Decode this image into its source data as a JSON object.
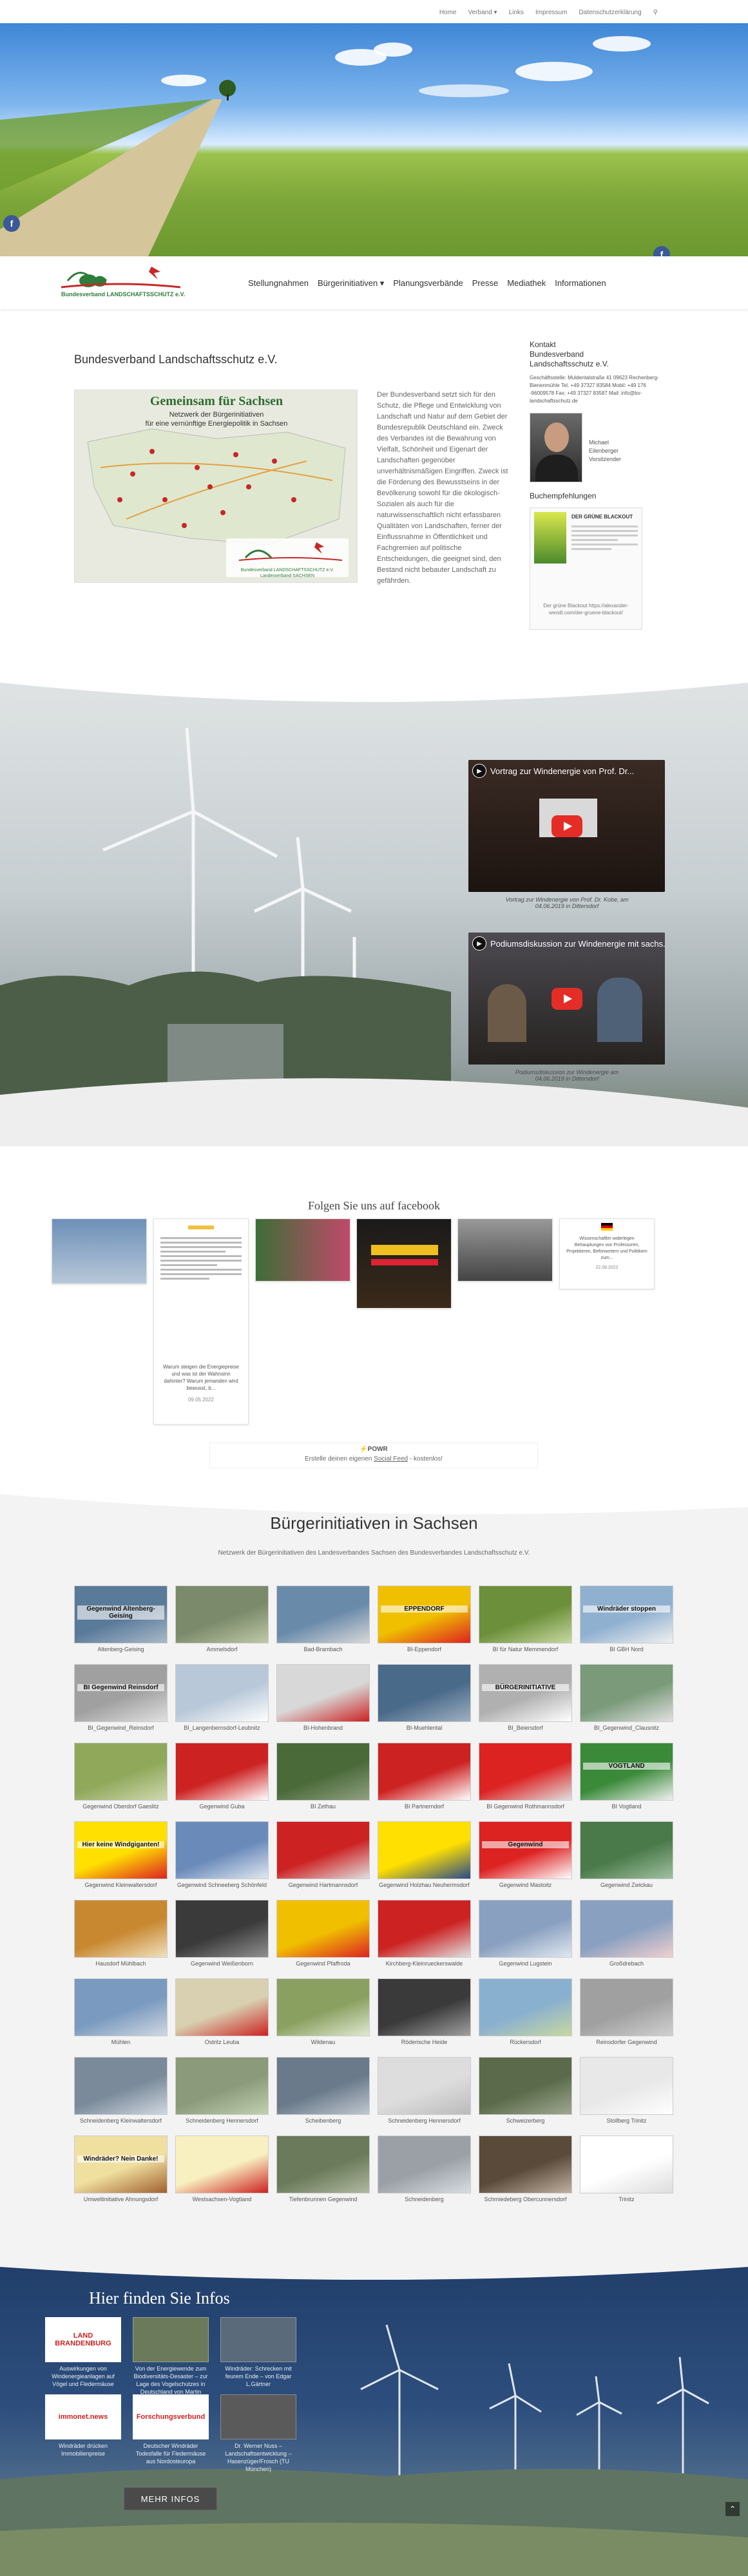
{
  "topnav": {
    "items": [
      "Home",
      "Verband",
      "Links",
      "Impressum",
      "Datenschutzerklärung"
    ]
  },
  "logo": {
    "text": "Bundesverband LANDSCHAFTSSCHUTZ e.V."
  },
  "menu": {
    "items": [
      "Stellungnahmen",
      "Bürgerinitiativen",
      "Planungsverbände",
      "Presse",
      "Mediathek",
      "Informationen"
    ]
  },
  "intro": {
    "heading": "Bundesverband Landschaftsschutz e.V.",
    "map_title": "Gemeinsam für Sachsen",
    "map_sub1": "Netzwerk der Bürgerinitiativen",
    "map_sub2": "für eine vernünftige Energiepolitik in Sachsen",
    "map_logo": "Bundesverband LANDSCHAFTSSCHUTZ e.V. Landesverband SACHSEN",
    "text": "Der Bundesverband setzt sich für den Schutz, die Pflege und Entwicklung von Landschaft und Natur auf dem Gebiet der Bundesrepublik Deutschland ein. Zweck des Verbandes ist die Bewahrung von Vielfalt, Schönheit und Eigenart der Landschaften gegenüber unverhältnismäßigen Eingriffen. Zweck ist die Förderung des Bewusstseins in der Bevölkerung sowohl für die ökologisch-Sozialen als auch für die naturwissenschaftlich nicht erfassbaren Qualitäten von Landschaften, ferner der Einflussnahme in Öffentlichkeit und Fachgremien auf politische Entscheidungen, die geeignet sind, den Bestand nicht bebauter Landschaft zu gefährden."
  },
  "sidebar": {
    "kontakt": "Kontakt",
    "org": "Bundesverband Landschaftsschutz e.V.",
    "address": "Geschäftsstelle: Muldentalstraße 41 09623 Rechenberg-Bienenmühle Tel. +49 37327 83584 Mobil: +49 176 -96009578 Fax: +49 37327 83587 Mail: info@bv-landschaftsschutz.de",
    "person": "Michael Eilenberger Vorsitzender",
    "buch_heading": "Buchempfehlungen",
    "book_title": "DER GRÜNE BLACKOUT",
    "book_caption": "Der grüne Blackout https://alexander-wendt.com/der-gruene-blackout/"
  },
  "videos": [
    {
      "title": "Vortrag zur Windenergie von Prof. Dr...",
      "caption": "Vortrag zur Windenergie von Prof. Dr. Kobe, am 04.06.2019 in Dittersdorf"
    },
    {
      "title": "Podiumsdiskussion zur Windenergie mit sachs...",
      "caption": "Podiumsdiskussion zur Windenergie am 04.06.2019 in Dittersdorf"
    }
  ],
  "facebook": {
    "heading": "Folgen Sie uns auf facebook",
    "post_text": "Warum steigen die Energiepreise und was ist der Wahnsinn dahinter? Warum jemanden wird bewusst, b...",
    "post_date": "09.05.2022",
    "post2_text": "Wissenschaftler widerlegen Behauptungen von Professoren, Projektieren, Befürwortern und Politikern zum...",
    "post2_date": "22.08.2022",
    "powr": "POWR",
    "powr_sub1": "Erstelle deinen eigenen",
    "powr_link": "Social Feed",
    "powr_sub2": "- kostenlos!"
  },
  "bi": {
    "heading": "Bürgerinitiativen in Sachsen",
    "sub": "Netzwerk der Bürgerinitiativen des Landesverbandes Sachsen des Bundesverbandes Landschaftsschutz e.V.",
    "items": [
      "Altenberg-Geising",
      "Ammelsdorf",
      "Bad-Brambach",
      "BI-Eppendorf",
      "BI für Natur Memmendorf",
      "BI GBH Nord",
      "BI_Gegenwind_Reinsdorf",
      "BI_Langenbernsdorf-Leubnitz",
      "BI-Hohenbrand",
      "BI-Muehlental",
      "BI_Beiersdorf",
      "BI_Gegenwind_Clausnitz",
      "Gegenwind Oberdorf Gaeslitz",
      "Gegenwind Guba",
      "BI Zethau",
      "BI Partnerndorf",
      "BI Gegenwind Rothmannsdorf",
      "BI Vogtland",
      "Gegenwind Kleinwaltersdorf",
      "Gegenwind Schneeberg Schönfeld",
      "Gegenwind Hartmannsdorf",
      "Gegenwind Holzhau Neuhermsdorf",
      "Gegenwind Mastoitz",
      "Gegenwind Zwickau",
      "Hausdorf Mühlbach",
      "Gegenwind Weißenborn",
      "Gegenwind Pfaffroda",
      "Kirchberg-Kleinrueckerswalde",
      "Gegenwind Lugstein",
      "Großdrebach",
      "Mühlen",
      "Ostritz Leuba",
      "Wildenau",
      "Röderische Heide",
      "Rückersdorf",
      "Reinsdorfer Gegenwind",
      "Schneidenberg Kleinwaltersdorf",
      "Schneidenberg Hennersdorf",
      "Scheibenberg",
      "Schneidenberg Hennersdorf",
      "Schweizerberg",
      "Stollberg Trinitz",
      "Umweltinitiative Ahnungsdorf",
      "Westsachsen-Vogtland",
      "Tiefenbrunnen Gegenwind",
      "Schneidenberg",
      "Schmiedeberg Obercunnersdorf",
      "Trinitz"
    ],
    "labels": {
      "i1": "Gegenwind Altenberg-Geising",
      "i4": "EPPENDORF",
      "i6": "Windräder stoppen",
      "i7": "BI Gegenwind Reinsdorf",
      "i11": "BÜRGERINITIATIVE",
      "i18": "VOGTLAND",
      "i19": "Hier keine Windgiganten!",
      "i23": "Gegenwind",
      "i43": "Windräder? Nein Danke!"
    }
  },
  "info": {
    "heading": "Hier finden Sie Infos",
    "items": [
      {
        "label": "LAND BRANDENBURG",
        "text": "Auswirkungen von Windenergieanlagen auf Vögel und Fledermäuse"
      },
      {
        "label": "",
        "text": "Von der Energiewende zum Biodiversitäts-Desaster – zur Lage des Vogelschutzes in Deutschland von Martin Flade"
      },
      {
        "label": "",
        "text": "Windräder: Schrecken mit feurem Ende – von Edgar L.Gärtner"
      },
      {
        "label": "immonet.news",
        "text": "Windräder drücken Immobilienpreise"
      },
      {
        "label": "Forschungsverbund",
        "text": "Deutscher Windräder Todesfalle für Fledermäuse aus Nordosteuropa"
      },
      {
        "label": "",
        "text": "Dr. Werner Nuss – Landschaftsentwicklung – Hasenzüger/Frosch (TU München)"
      }
    ],
    "button": "MEHR INFOS"
  },
  "colors": {
    "facebook": "#3b5998",
    "youtube": "#e52d27",
    "logo_green": "#2f7d3a",
    "logo_red": "#c62828"
  }
}
